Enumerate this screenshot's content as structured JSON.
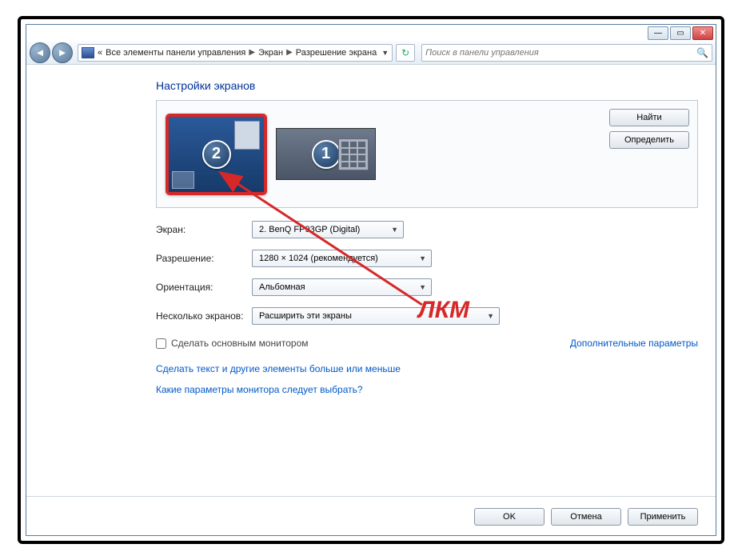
{
  "breadcrumb": {
    "prefix": "«",
    "items": [
      "Все элементы панели управления",
      "Экран",
      "Разрешение экрана"
    ]
  },
  "search": {
    "placeholder": "Поиск в панели управления"
  },
  "page_title": "Настройки экранов",
  "monitors": {
    "num1": "1",
    "num2": "2"
  },
  "buttons": {
    "find": "Найти",
    "identify": "Определить",
    "ok": "OK",
    "cancel": "Отмена",
    "apply": "Применить"
  },
  "labels": {
    "display": "Экран:",
    "resolution": "Разрешение:",
    "orientation": "Ориентация:",
    "multiple": "Несколько экранов:"
  },
  "values": {
    "display": "2. BenQ FP93GP (Digital)",
    "resolution": "1280 × 1024 (рекомендуется)",
    "orientation": "Альбомная",
    "multiple": "Расширить эти экраны"
  },
  "checkbox_label": "Сделать основным монитором",
  "links": {
    "advanced": "Дополнительные параметры",
    "textsize": "Сделать текст и другие элементы больше или меньше",
    "which": "Какие параметры монитора следует выбрать?"
  },
  "annotation": "ЛКМ"
}
